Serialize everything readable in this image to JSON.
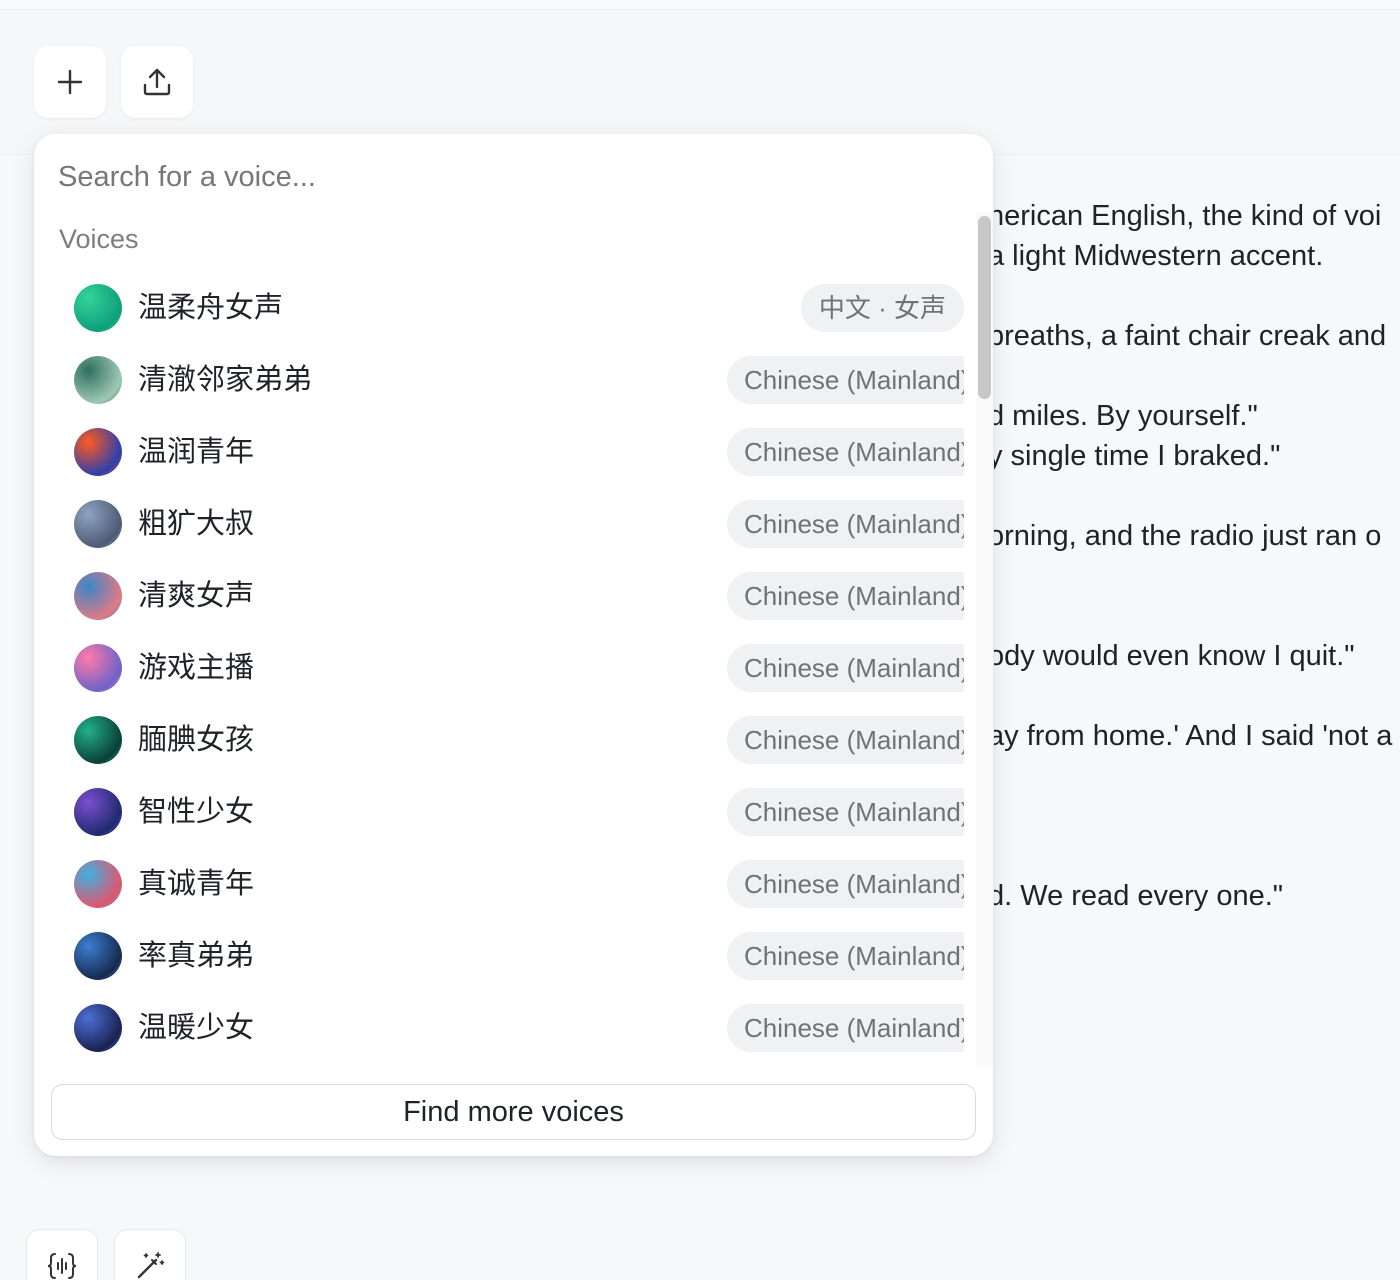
{
  "toolbar": {
    "add_icon": "plus-icon",
    "upload_icon": "upload-icon"
  },
  "editor": {
    "lines": [
      "nerican English, the kind of voi",
      "a light Midwestern accent.",
      "breaths, a faint chair creak and",
      "d miles. By yourself.\"",
      "y single time I braked.\"",
      "orning, and the radio just ran o",
      "ody would even know I quit.\"",
      "ay from home.' And I said 'not a",
      "d. We read every one.\""
    ]
  },
  "voice_picker": {
    "search_placeholder": "Search for a voice...",
    "section_label": "Voices",
    "voices": [
      {
        "name": "温柔舟女声",
        "tag": "中文 · 女声",
        "avatar_colors": [
          "#34d399",
          "#0f9f7a"
        ]
      },
      {
        "name": "清澈邻家弟弟",
        "tag": "Chinese (Mainland)",
        "avatar_colors": [
          "#2f6f5e",
          "#9ec9b5"
        ]
      },
      {
        "name": "温润青年",
        "tag": "Chinese (Mainland)",
        "avatar_colors": [
          "#ff5a1f",
          "#2b3fae"
        ]
      },
      {
        "name": "粗犷大叔",
        "tag": "Chinese (Mainland)",
        "avatar_colors": [
          "#8fa3c2",
          "#4e5a74"
        ]
      },
      {
        "name": "清爽女声",
        "tag": "Chinese (Mainland)",
        "avatar_colors": [
          "#3a86c8",
          "#e07a86"
        ]
      },
      {
        "name": "游戏主播",
        "tag": "Chinese (Mainland)",
        "avatar_colors": [
          "#ff7aa8",
          "#6d63c9"
        ]
      },
      {
        "name": "腼腆女孩",
        "tag": "Chinese (Mainland)",
        "avatar_colors": [
          "#22b08a",
          "#0b3f3a"
        ]
      },
      {
        "name": "智性少女",
        "tag": "Chinese (Mainland)",
        "avatar_colors": [
          "#7b4fd0",
          "#1f2a6e"
        ]
      },
      {
        "name": "真诚青年",
        "tag": "Chinese (Mainland)",
        "avatar_colors": [
          "#3fb0e0",
          "#e0566e"
        ]
      },
      {
        "name": "率真弟弟",
        "tag": "Chinese (Mainland)",
        "avatar_colors": [
          "#3b7fd0",
          "#18294f"
        ]
      },
      {
        "name": "温暖少女",
        "tag": "Chinese (Mainland)",
        "avatar_colors": [
          "#4b6fd6",
          "#1b2250"
        ]
      }
    ],
    "find_more_label": "Find more voices"
  },
  "bottom_toolbar": {
    "left_icon": "voice-code-icon",
    "right_icon": "magic-wand-icon"
  }
}
